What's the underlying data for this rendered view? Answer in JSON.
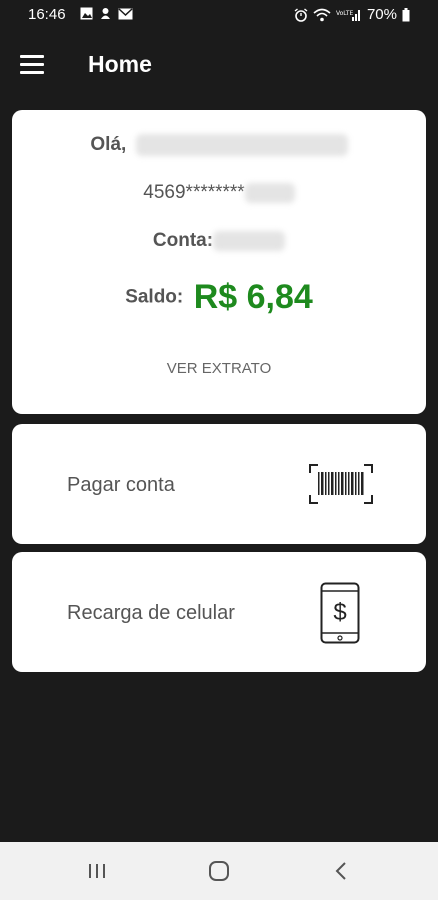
{
  "status_bar": {
    "time": "16:46",
    "battery": "70%",
    "left_icons": [
      "image-icon",
      "notification-icon",
      "mail-icon"
    ],
    "right_icons": [
      "alarm-icon",
      "wifi-icon",
      "signal-icon",
      "battery-icon"
    ]
  },
  "app_bar": {
    "title": "Home",
    "menu_icon": "hamburger-menu-icon"
  },
  "account_card": {
    "greeting_label": "Olá,",
    "card_number_prefix": "4569********",
    "account_label": "Conta:",
    "balance_label": "Saldo:",
    "balance_value": "R$ 6,84",
    "statement_link": "VER EXTRATO"
  },
  "actions": {
    "pay_bill": {
      "label": "Pagar conta",
      "icon": "barcode-scan-icon"
    },
    "phone_topup": {
      "label": "Recarga de celular",
      "icon": "phone-dollar-icon"
    }
  },
  "nav_bar": {
    "buttons": [
      "recent-apps-icon",
      "home-icon",
      "back-icon"
    ]
  },
  "colors": {
    "background": "#1b1b1b",
    "card": "#ffffff",
    "balance": "#1e8a1e",
    "text": "#555555"
  }
}
